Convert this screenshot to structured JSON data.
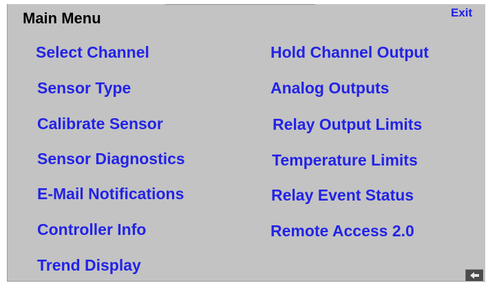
{
  "menu": {
    "title": "Main Menu",
    "exit_label": "Exit",
    "left_items": [
      {
        "label": "Select Channel"
      },
      {
        "label": "Sensor Type"
      },
      {
        "label": "Calibrate Sensor"
      },
      {
        "label": "Sensor Diagnostics"
      },
      {
        "label": "E-Mail Notifications"
      },
      {
        "label": "Controller Info"
      },
      {
        "label": "Trend Display"
      }
    ],
    "right_items": [
      {
        "label": "Hold Channel Output"
      },
      {
        "label": "Analog Outputs"
      },
      {
        "label": "Relay Output Limits"
      },
      {
        "label": "Temperature Limits"
      },
      {
        "label": "Relay Event Status"
      },
      {
        "label": "Remote Access 2.0"
      }
    ]
  },
  "colors": {
    "background": "#c3c3c3",
    "item_text": "#2323e6",
    "title_text": "#000000"
  },
  "icons": {
    "back": "back-arrow-icon"
  }
}
